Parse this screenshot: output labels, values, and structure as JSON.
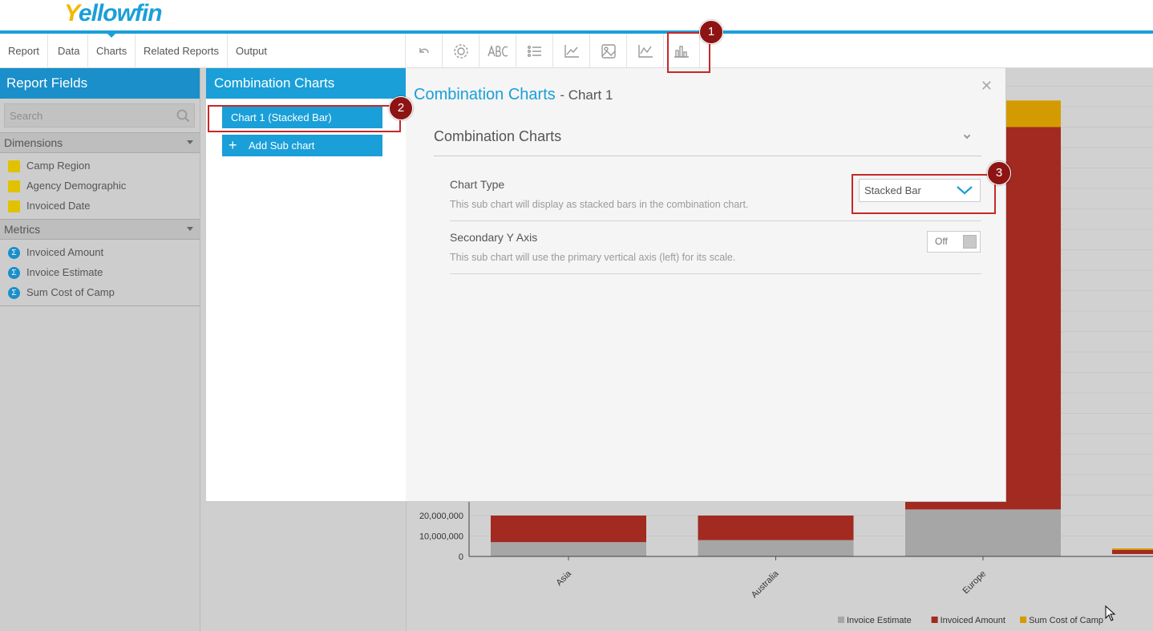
{
  "header": {
    "logo_first": "Y",
    "logo_rest": "ellowfin"
  },
  "nav": {
    "tabs": [
      {
        "label": "Report"
      },
      {
        "label": "Data"
      },
      {
        "label": "Charts"
      },
      {
        "label": "Related Reports"
      },
      {
        "label": "Output"
      }
    ],
    "active_tab": "Charts",
    "toolbar_icons": [
      "undo-icon",
      "gear-icon",
      "text-abc-icon",
      "list-icon",
      "axis-icon",
      "image-icon",
      "line-chart-icon",
      "combination-chart-icon"
    ]
  },
  "report_fields": {
    "title": "Report Fields",
    "search_placeholder": "Search",
    "dimensions_label": "Dimensions",
    "dimensions": [
      "Camp Region",
      "Agency Demographic",
      "Invoiced Date"
    ],
    "metrics_label": "Metrics",
    "metrics": [
      "Invoiced Amount",
      "Invoice Estimate",
      "Sum Cost of Camp"
    ]
  },
  "dialog": {
    "list_title": "Combination Charts",
    "sub_charts": [
      "Chart 1 (Stacked Bar)"
    ],
    "add_label": "Add Sub chart",
    "title": "Combination Charts",
    "title_suffix": "- Chart 1",
    "section_title": "Combination Charts",
    "chart_type": {
      "title": "Chart Type",
      "description": "This sub chart will display as stacked bars in the combination chart.",
      "value": "Stacked Bar"
    },
    "secondary_axis": {
      "title": "Secondary Y Axis",
      "description": "This sub chart will use the primary vertical axis (left) for its scale.",
      "value": "Off"
    }
  },
  "annotations": [
    "1",
    "2",
    "3"
  ],
  "colors": {
    "accent": "#1a9fd8",
    "callout": "#8e1414",
    "invoice_estimate": "#a6a6a6",
    "invoiced_amount": "#a22a20",
    "sum_cost_of_camp": "#d49b00"
  },
  "chart_data": {
    "type": "bar",
    "stacked": true,
    "categories": [
      "Asia",
      "Australia",
      "Europe"
    ],
    "y_tick_labels": [
      "0",
      "10,000,000",
      "20,000,000"
    ],
    "series": [
      {
        "name": "Invoice Estimate",
        "values": [
          7000000,
          8000000,
          23000000
        ]
      },
      {
        "name": "Invoiced Amount",
        "values": [
          13000000,
          12000000,
          187000000
        ]
      },
      {
        "name": "Sum Cost of Camp",
        "values": [
          0,
          0,
          13000000
        ]
      }
    ],
    "ylim": [
      0,
      240000000
    ],
    "legend_position": "bottom-right"
  }
}
